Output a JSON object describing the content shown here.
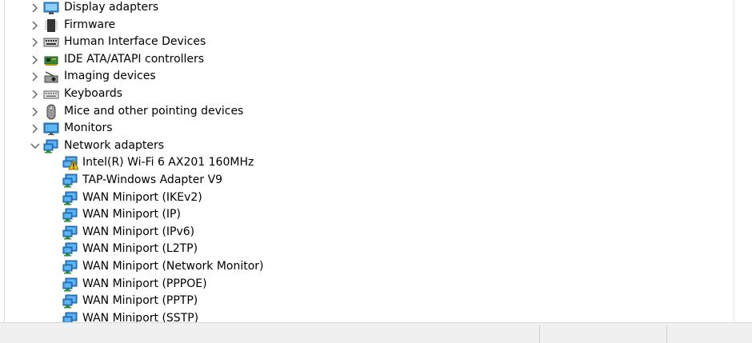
{
  "tree": {
    "categories": [
      {
        "label": "Display adapters",
        "icon": "display-adapter-icon",
        "expanded": false
      },
      {
        "label": "Firmware",
        "icon": "firmware-icon",
        "expanded": false
      },
      {
        "label": "Human Interface Devices",
        "icon": "hid-icon",
        "expanded": false
      },
      {
        "label": "IDE ATA/ATAPI controllers",
        "icon": "ide-controller-icon",
        "expanded": false
      },
      {
        "label": "Imaging devices",
        "icon": "imaging-device-icon",
        "expanded": false
      },
      {
        "label": "Keyboards",
        "icon": "keyboard-icon",
        "expanded": false
      },
      {
        "label": "Mice and other pointing devices",
        "icon": "mouse-icon",
        "expanded": false
      },
      {
        "label": "Monitors",
        "icon": "monitor-icon",
        "expanded": false
      },
      {
        "label": "Network adapters",
        "icon": "network-adapter-icon",
        "expanded": true
      }
    ],
    "network_adapters": [
      {
        "label": "Intel(R) Wi-Fi 6 AX201 160MHz",
        "warning": true
      },
      {
        "label": "TAP-Windows Adapter V9",
        "warning": false
      },
      {
        "label": "WAN Miniport (IKEv2)",
        "warning": false
      },
      {
        "label": "WAN Miniport (IP)",
        "warning": false
      },
      {
        "label": "WAN Miniport (IPv6)",
        "warning": false
      },
      {
        "label": "WAN Miniport (L2TP)",
        "warning": false
      },
      {
        "label": "WAN Miniport (Network Monitor)",
        "warning": false
      },
      {
        "label": "WAN Miniport (PPPOE)",
        "warning": false
      },
      {
        "label": "WAN Miniport (PPTP)",
        "warning": false
      },
      {
        "label": "WAN Miniport (SSTP)",
        "warning": false
      }
    ]
  },
  "colors": {
    "network_blue": "#2b8ad8",
    "warning_yellow": "#f5c400"
  }
}
